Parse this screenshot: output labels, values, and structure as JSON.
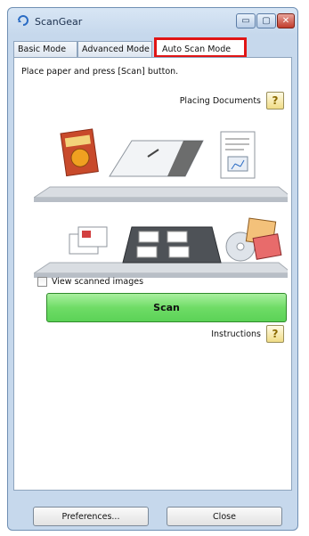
{
  "window": {
    "title": "ScanGear"
  },
  "tabs": [
    {
      "label": "Basic Mode"
    },
    {
      "label": "Advanced Mode"
    },
    {
      "label": "Auto Scan Mode"
    }
  ],
  "panel": {
    "instruction": "Place paper and press [Scan] button.",
    "placing_documents_label": "Placing Documents",
    "view_scanned_images_label": "View scanned images",
    "scan_button_label": "Scan",
    "instructions_label": "Instructions",
    "view_scanned_images_checked": false
  },
  "footer": {
    "preferences_label": "Preferences...",
    "close_label": "Close"
  },
  "colors": {
    "active_tab_outline": "#e01515",
    "scan_button": "#6fdc66",
    "help_button": "#f0dc86"
  },
  "icons": {
    "app": "scangear-app-icon",
    "help": "question-mark-icon"
  }
}
